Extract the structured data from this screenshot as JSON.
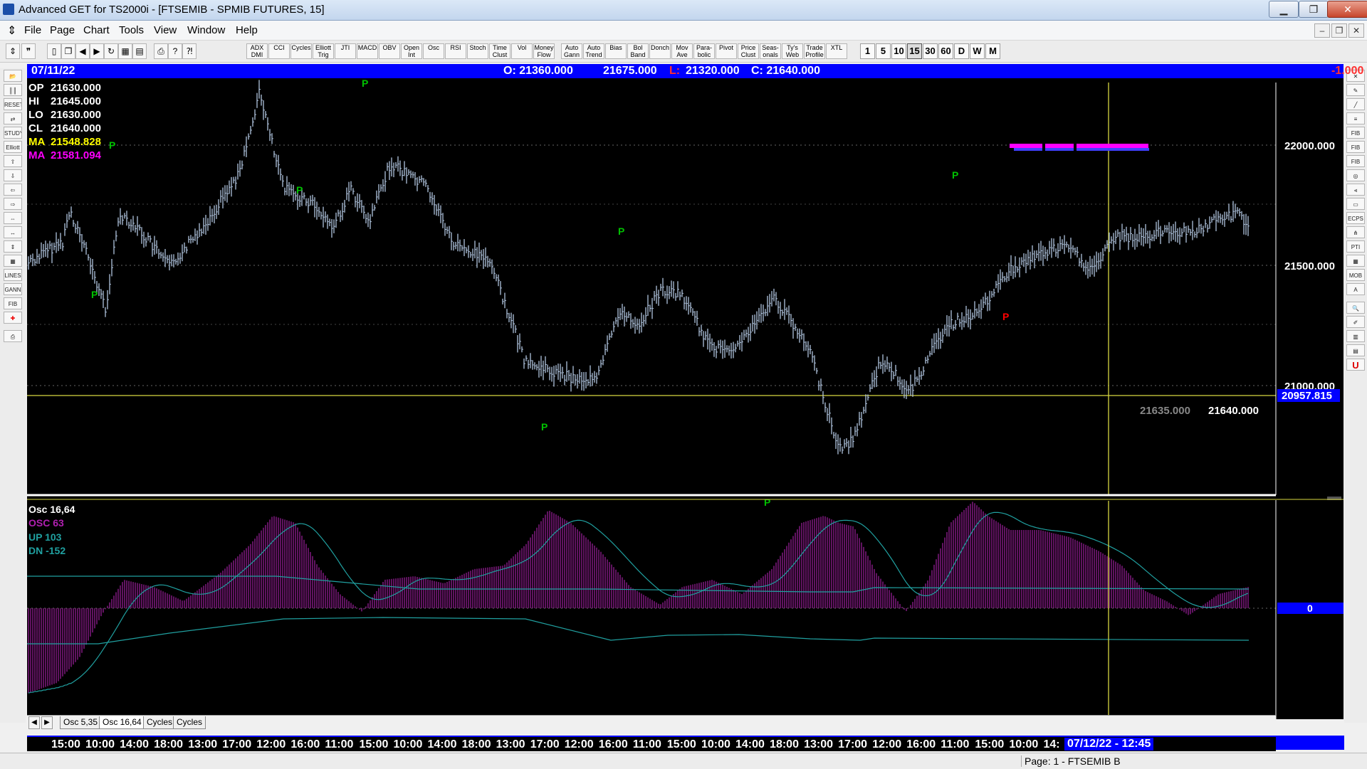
{
  "window": {
    "title": "Advanced GET for TS2000i - [FTSEMIB - SPMIB FUTURES, 15]",
    "minimize": "▁",
    "maximize": "❐",
    "close": "✕"
  },
  "menu": {
    "items": [
      "File",
      "Page",
      "Chart",
      "Tools",
      "View",
      "Window",
      "Help"
    ],
    "mdi_minimize": "–",
    "mdi_restore": "❐",
    "mdi_close": "✕"
  },
  "toolbar": {
    "study_buttons": [
      "ADX DMI",
      "CCI",
      "Cycles",
      "Elliott Trig",
      "JTI",
      "MACD",
      "OBV",
      "Open Int",
      "Osc",
      "RSI",
      "Stoch",
      "Time Clust",
      "Vol",
      "Money Flow",
      "Auto Gann",
      "Auto Trend",
      "Bias",
      "Bol Band",
      "Donch",
      "Mov Ave",
      "Para- bolic",
      "Pivot",
      "Price Clust",
      "Seas- onals",
      "Ty's Web",
      "Trade Profile",
      "XTL"
    ],
    "timeframes": [
      "1",
      "5",
      "10",
      "15",
      "30",
      "60",
      "D",
      "W",
      "M"
    ],
    "active_timeframe": "15"
  },
  "info": {
    "date": "07/11/22",
    "open": "O: 21360.000",
    "high": "21675.000",
    "low_label": "L:",
    "low": "21320.000",
    "close": "C: 21640.000",
    "change": "-1.000"
  },
  "price_legend": {
    "op_label": "OP",
    "op": "21630.000",
    "hi_label": "HI",
    "hi": "21645.000",
    "lo_label": "LO",
    "lo": "21630.000",
    "cl_label": "CL",
    "cl": "21640.000",
    "ma1_label": "MA",
    "ma1": "21548.828",
    "ma2_label": "MA",
    "ma2": "21581.094"
  },
  "price_axis": {
    "labels": [
      "22000.000",
      "21500.000",
      "21000.000"
    ],
    "cursor_value": "20957.815",
    "bottom_left": "21635.000",
    "bottom_right": "21640.000"
  },
  "osc_legend": {
    "title": "Osc 16,64",
    "osc": "OSC 63",
    "up": "UP   103",
    "dn": "DN   -152",
    "zero": "0"
  },
  "pivot_marker": "P",
  "tabs": [
    "Osc 5,35",
    "Osc 16,64",
    "Cycles",
    "Cycles"
  ],
  "active_tab": "Osc 16,64",
  "time_axis": {
    "labels": [
      "15:00",
      "10:00",
      "14:00",
      "18:00",
      "13:00",
      "17:00",
      "12:00",
      "16:00",
      "11:00",
      "15:00",
      "10:00",
      "14:00",
      "18:00",
      "13:00",
      "17:00",
      "12:00",
      "16:00",
      "11:00",
      "15:00",
      "10:00",
      "14:00",
      "18:00",
      "13:00",
      "17:00",
      "12:00",
      "16:00",
      "11:00",
      "15:00",
      "10:00",
      "14:"
    ],
    "current": "07/12/22 - 12:45"
  },
  "status": {
    "page": "Page: 1 - FTSEMIB B"
  },
  "colors": {
    "price_bars": "#b0c4de",
    "ma_yellow": "#ffff00",
    "ma_magenta": "#ff00ff",
    "pivot_green": "#00c000",
    "pivot_red": "#ff0000",
    "osc_bars": "#a020a0",
    "band_lines": "#20a0a0",
    "header_blue": "#0000ff"
  }
}
